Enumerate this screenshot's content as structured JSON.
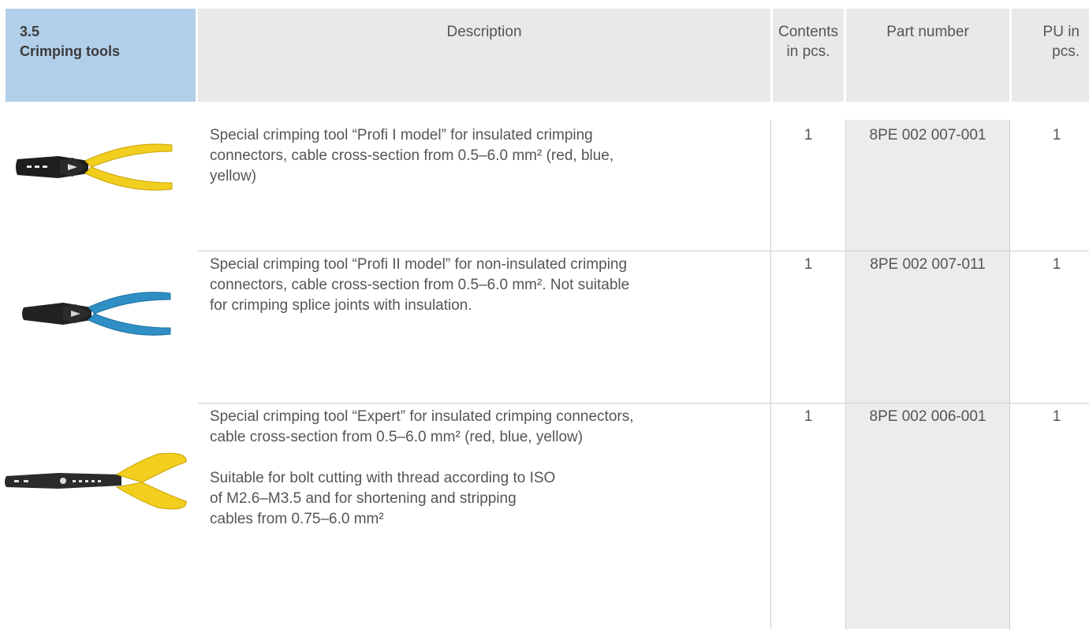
{
  "header": {
    "section_number": "3.5",
    "section_title": "Crimping tools",
    "col_description": "Description",
    "col_contents_line1": "Contents",
    "col_contents_line2": "in pcs.",
    "col_part_number": "Part number",
    "col_pu_line1": "PU in",
    "col_pu_line2": "pcs."
  },
  "rows": [
    {
      "tool_image": "crimping-tool-yellow-handles-icon",
      "description": [
        "Special crimping tool “Profi I model” for insulated crimping",
        "connectors, cable cross-section from 0.5–6.0 mm² (red, blue,",
        "yellow)"
      ],
      "contents": "1",
      "part_number": "8PE 002 007-001",
      "pu": "1"
    },
    {
      "tool_image": "crimping-tool-blue-handles-icon",
      "description": [
        "Special crimping tool “Profi II model” for non-insulated crimping",
        "connectors, cable cross-section from 0.5–6.0 mm². Not suitable",
        "for crimping splice joints with insulation."
      ],
      "contents": "1",
      "part_number": "8PE 002 007-011",
      "pu": "1"
    },
    {
      "tool_image": "crimping-stripping-tool-yellow-handles-icon",
      "description": [
        "Special crimping tool “Expert” for insulated crimping connectors,",
        "cable cross-section from 0.5–6.0 mm² (red, blue, yellow)"
      ],
      "description_extra": [
        "Suitable for bolt cutting with thread according to ISO",
        "of M2.6–M3.5 and for shortening and stripping",
        "cables from 0.75–6.0 mm²"
      ],
      "contents": "1",
      "part_number": "8PE 002 006-001",
      "pu": "1"
    }
  ],
  "colors": {
    "section_header_bg": "#b2cfe9",
    "header_bg": "#e8e9ea",
    "part_number_bg": "#ececed",
    "yellow_handle": "#f2cf1f",
    "blue_handle": "#2f8fc4"
  }
}
